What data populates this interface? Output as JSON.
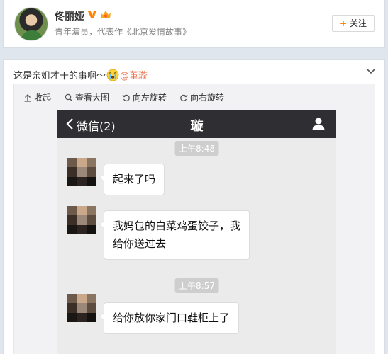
{
  "profile": {
    "name": "佟丽娅",
    "bio": "青年演员，代表作《北京爱情故事》",
    "follow_label": "关注",
    "follow_plus": "+",
    "verified_badge": "vip-v-icon",
    "member_badge": "member-crown-icon"
  },
  "post": {
    "text": "这是亲姐才干的事啊～",
    "emoji": "crying-emoji",
    "mention": "@董璇"
  },
  "toolbar": {
    "collapse": "收起",
    "view_large": "查看大图",
    "rotate_left": "向左旋转",
    "rotate_right": "向右旋转"
  },
  "chat": {
    "back_label": "微信(2)",
    "title": "璇",
    "messages": [
      {
        "timestamp": "上午8:48",
        "text": "起来了吗"
      },
      {
        "text_line1": "我妈包的白菜鸡蛋饺子，我",
        "text_line2": "给你送过去"
      },
      {
        "timestamp": "上午8:57",
        "text": "给你放你家门口鞋柜上了"
      }
    ]
  },
  "colors": {
    "accent_orange": "#ff8200",
    "mention": "#eb7350",
    "wechat_header": "#2e2e33",
    "chat_bg": "#ebebeb",
    "timestamp_bg": "#cecece"
  }
}
